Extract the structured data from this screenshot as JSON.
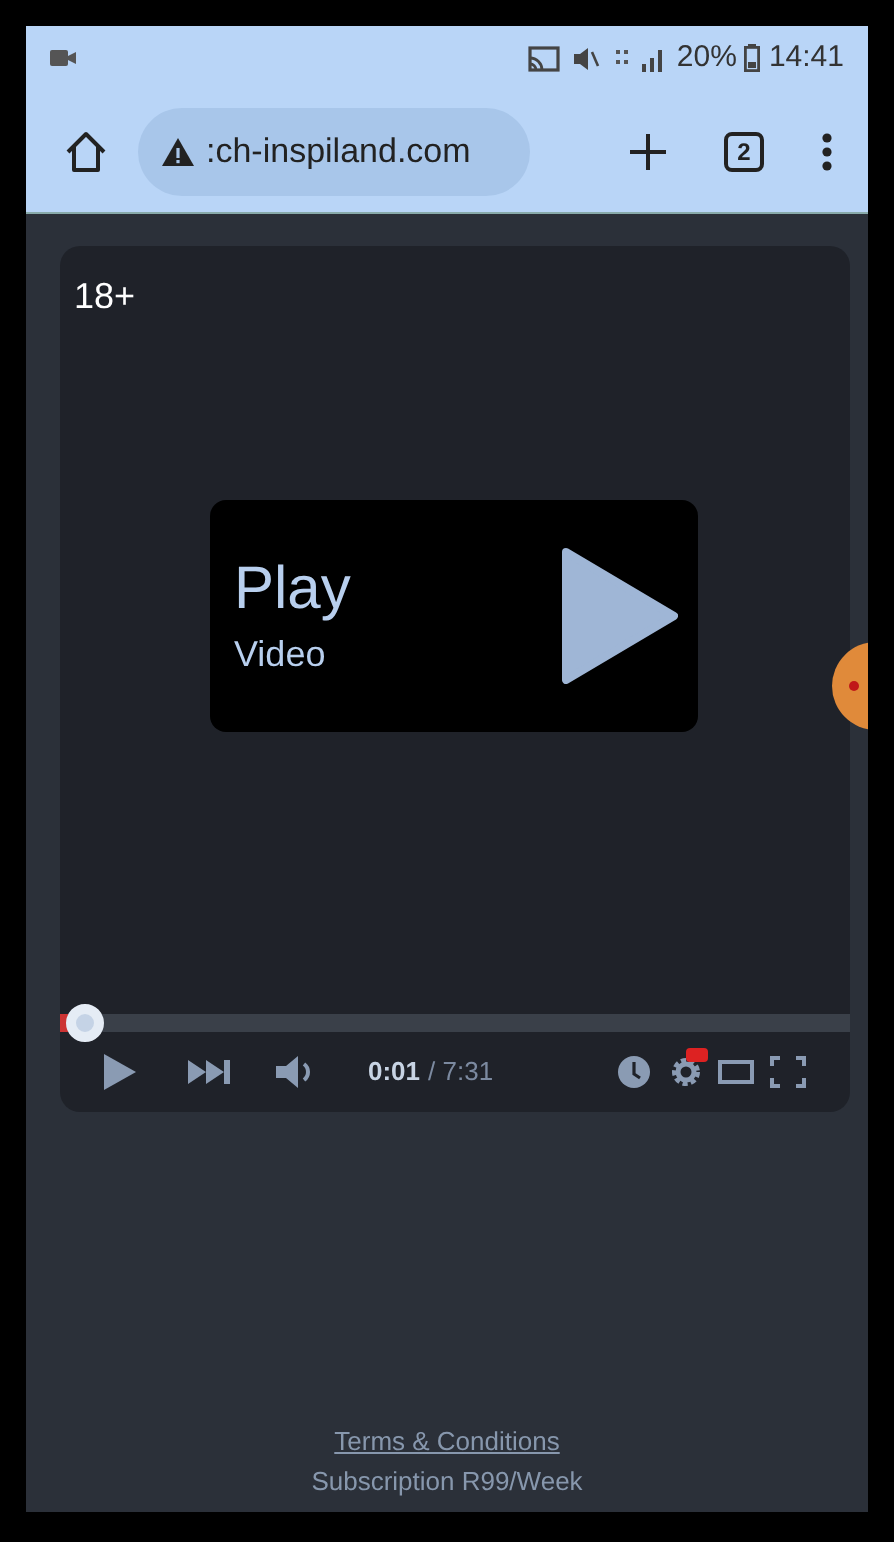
{
  "status_bar": {
    "battery": "20%",
    "time": "14:41"
  },
  "browser": {
    "url": ":ch-inspiland.com",
    "tab_count": "2"
  },
  "player": {
    "age_badge": "18+",
    "play_title": "Play",
    "play_subtitle": "Video",
    "progress": {
      "level": 0.01
    },
    "current_time": "0:01",
    "duration": "/ 7:31",
    "hd_badge": true
  },
  "footer": {
    "link": "Terms & Conditions",
    "note": "Subscription R99/Week"
  }
}
